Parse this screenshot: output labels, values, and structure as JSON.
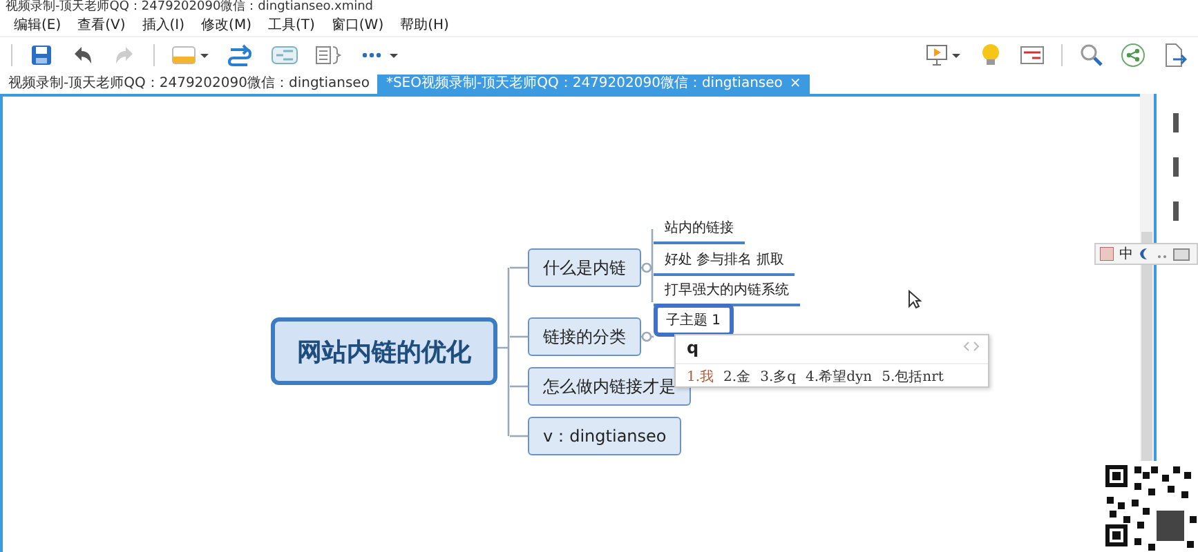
{
  "window": {
    "title": "视频录制-顶天老师QQ：2479202090微信：dingtianseo.xmind"
  },
  "menu": [
    "编辑(E)",
    "查看(V)",
    "插入(I)",
    "修改(M)",
    "工具(T)",
    "窗口(W)",
    "帮助(H)"
  ],
  "tabs": [
    {
      "label": "视频录制-顶天老师QQ：2479202090微信：dingtianseo",
      "selected": false
    },
    {
      "label": "*SEO视频录制-顶天老师QQ：2479202090微信：dingtianseo",
      "selected": true,
      "close": "×"
    }
  ],
  "map": {
    "central": "网站内链的优化",
    "branches": [
      {
        "label": "什么是内链",
        "children": [
          {
            "label": "站内的链接",
            "editing": false
          },
          {
            "label": "好处  参与排名  抓取",
            "editing": false
          },
          {
            "label": "打早强大的内链系统",
            "editing": false
          }
        ]
      },
      {
        "label": "链接的分类",
        "children": [
          {
            "label": "子主题 1",
            "editing": true
          }
        ]
      },
      {
        "label": "怎么做内链接才是"
      },
      {
        "label": "v：dingtianseo"
      }
    ]
  },
  "ime": {
    "input": "q",
    "candidates": [
      "1.我",
      "2.金",
      "3.多q",
      "4.希望dyn",
      "5.包括nrt"
    ]
  },
  "ime_status": {
    "mode": "中"
  }
}
